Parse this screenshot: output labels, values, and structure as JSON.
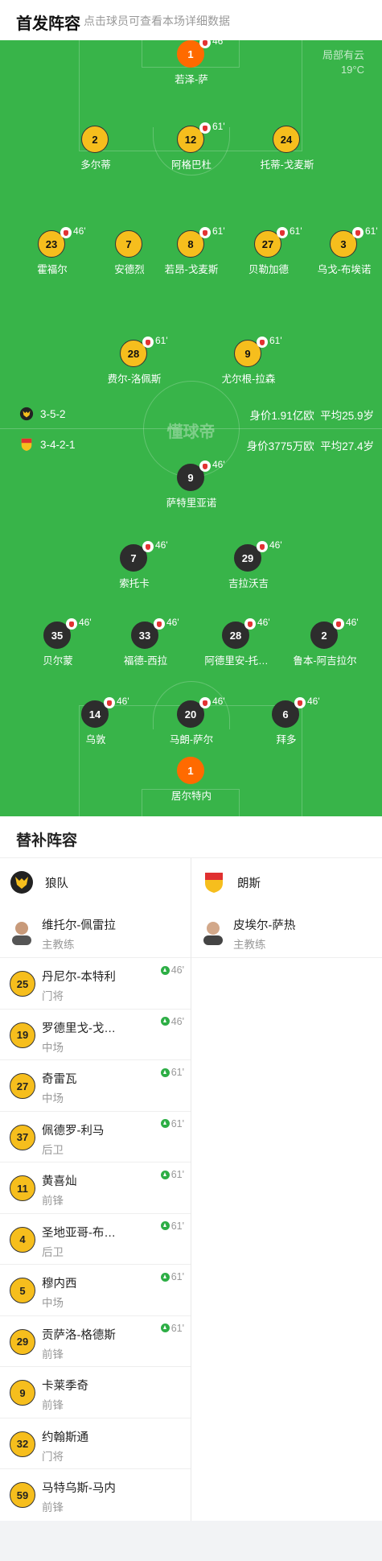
{
  "header": {
    "title": "首发阵容",
    "hint": "点击球员可查看本场详细数据"
  },
  "weather": {
    "condition": "局部有云",
    "temp": "19°C"
  },
  "watermark": "懂球帝",
  "home_team": {
    "formation": "3-5-2",
    "value": "身价1.91亿欧",
    "avg_age": "平均25.9岁"
  },
  "away_team": {
    "formation": "3-4-2-1",
    "value": "身价3775万欧",
    "avg_age": "平均27.4岁"
  },
  "home_players": [
    {
      "num": "1",
      "name": "若泽-萨",
      "sub": "46'"
    },
    {
      "num": "2",
      "name": "多尔蒂",
      "sub": ""
    },
    {
      "num": "12",
      "name": "阿格巴杜",
      "sub": "61'"
    },
    {
      "num": "24",
      "name": "托蒂-戈麦斯",
      "sub": ""
    },
    {
      "num": "23",
      "name": "霍福尔",
      "sub": "46'"
    },
    {
      "num": "7",
      "name": "安德烈",
      "sub": ""
    },
    {
      "num": "8",
      "name": "若昂-戈麦斯",
      "sub": "61'"
    },
    {
      "num": "27",
      "name": "贝勒加德",
      "sub": "61'"
    },
    {
      "num": "3",
      "name": "乌戈-布埃诺",
      "sub": "61'"
    },
    {
      "num": "28",
      "name": "费尔-洛佩斯",
      "sub": "61'"
    },
    {
      "num": "9",
      "name": "尤尔根-拉森",
      "sub": "61'"
    }
  ],
  "away_players": [
    {
      "num": "9",
      "name": "萨特里亚诺",
      "sub": "46'"
    },
    {
      "num": "7",
      "name": "索托卡",
      "sub": "46'"
    },
    {
      "num": "29",
      "name": "吉拉沃吉",
      "sub": "46'"
    },
    {
      "num": "35",
      "name": "贝尔蒙",
      "sub": "46'"
    },
    {
      "num": "33",
      "name": "福德-西拉",
      "sub": "46'"
    },
    {
      "num": "28",
      "name": "阿德里安-托…",
      "sub": "46'"
    },
    {
      "num": "2",
      "name": "鲁本-阿吉拉尔",
      "sub": "46'"
    },
    {
      "num": "14",
      "name": "乌敦",
      "sub": "46'"
    },
    {
      "num": "20",
      "name": "马朗-萨尔",
      "sub": "46'"
    },
    {
      "num": "6",
      "name": "拜多",
      "sub": "46'"
    },
    {
      "num": "1",
      "name": "居尔特内",
      "sub": ""
    }
  ],
  "subs": {
    "title": "替补阵容",
    "home": {
      "team": "狼队",
      "coach": {
        "name": "维托尔-佩雷拉",
        "role": "主教练"
      }
    },
    "away": {
      "team": "朗斯",
      "coach": {
        "name": "皮埃尔-萨热",
        "role": "主教练"
      }
    },
    "home_list": [
      {
        "num": "25",
        "name": "丹尼尔-本特利",
        "pos": "门将",
        "on": "46'"
      },
      {
        "num": "19",
        "name": "罗德里戈-戈…",
        "pos": "中场",
        "on": "46'"
      },
      {
        "num": "27",
        "name": "奇雷瓦",
        "pos": "中场",
        "on": "61'"
      },
      {
        "num": "37",
        "name": "佩德罗-利马",
        "pos": "后卫",
        "on": "61'"
      },
      {
        "num": "11",
        "name": "黄喜灿",
        "pos": "前锋",
        "on": "61'"
      },
      {
        "num": "4",
        "name": "圣地亚哥-布…",
        "pos": "后卫",
        "on": "61'"
      },
      {
        "num": "5",
        "name": "穆内西",
        "pos": "中场",
        "on": "61'"
      },
      {
        "num": "29",
        "name": "贡萨洛-格德斯",
        "pos": "前锋",
        "on": "61'"
      },
      {
        "num": "9",
        "name": "卡莱季奇",
        "pos": "前锋",
        "on": ""
      },
      {
        "num": "32",
        "name": "约翰斯通",
        "pos": "门将",
        "on": ""
      },
      {
        "num": "59",
        "name": "马特乌斯-马内",
        "pos": "前锋",
        "on": ""
      }
    ]
  },
  "colors": {
    "pitch": "#38b449",
    "home_ball": "#f6be1d",
    "away_ball": "#2d2d2d",
    "keeper": "#ff6a00"
  }
}
